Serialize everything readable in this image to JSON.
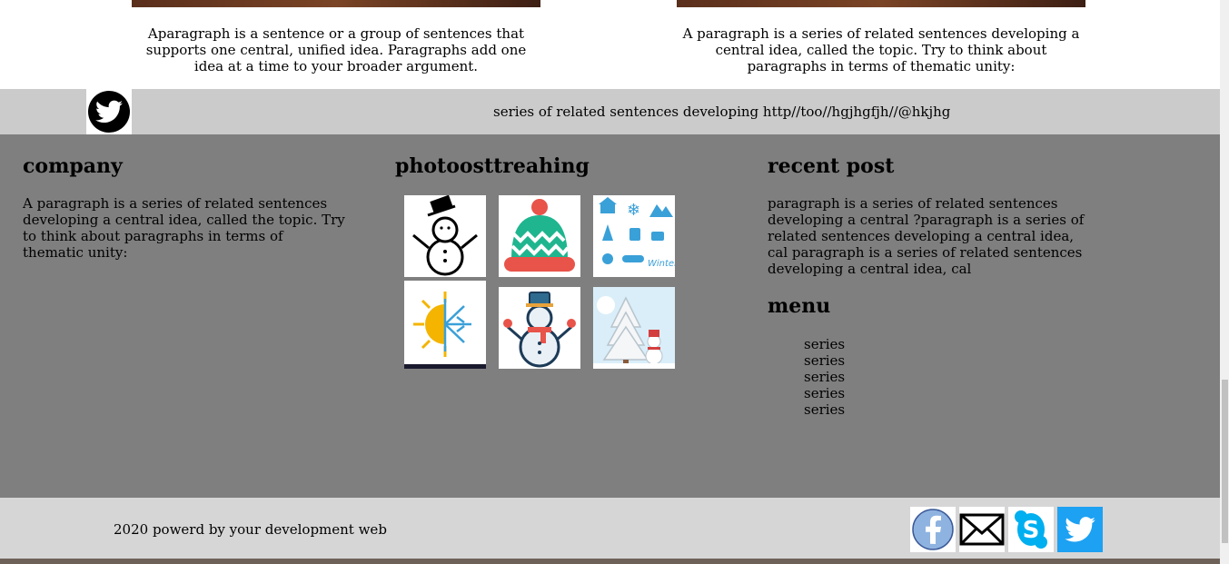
{
  "top": {
    "left_paragraph": "Aparagraph is a sentence or a group of sentences that supports one central, unified idea. Paragraphs add one idea at a time to your broader argument.",
    "right_paragraph": "A paragraph is a series of related sentences developing a central idea, called the topic. Try to think about paragraphs in terms of thematic unity:"
  },
  "twitter_bar": {
    "icon": "twitter-icon",
    "text": "series of related sentences developing http//too//hgjhgfjh//@hkjhg"
  },
  "company": {
    "title": "company",
    "text": "A paragraph is a series of related sentences developing a central idea, called the topic. Try to think about paragraphs in terms of thematic unity:"
  },
  "gallery": {
    "title": "photoosttreahing",
    "images": [
      "snowman-icon",
      "winter-hat-icon",
      "winter-icons-set",
      "sun-snowflake-icon",
      "snowman-scarf-icon",
      "snowy-tree-snowman-icon"
    ]
  },
  "recent_post": {
    "title": "recent post",
    "text": "paragraph is a series of related sentences developing a central ?paragraph is a series of related sentences developing a central idea, cal paragraph is a series of related sentences developing a central idea, cal"
  },
  "menu": {
    "title": "menu",
    "items": [
      "series",
      "series",
      "series",
      "series",
      "series"
    ]
  },
  "footer": {
    "copyright": "2020 powerd by your development web",
    "social": [
      "facebook-icon",
      "mail-icon",
      "skype-icon",
      "twitter-icon"
    ],
    "colors": {
      "facebook": "#3b5998",
      "skype": "#00aff0",
      "twitter": "#1da1f2"
    }
  }
}
